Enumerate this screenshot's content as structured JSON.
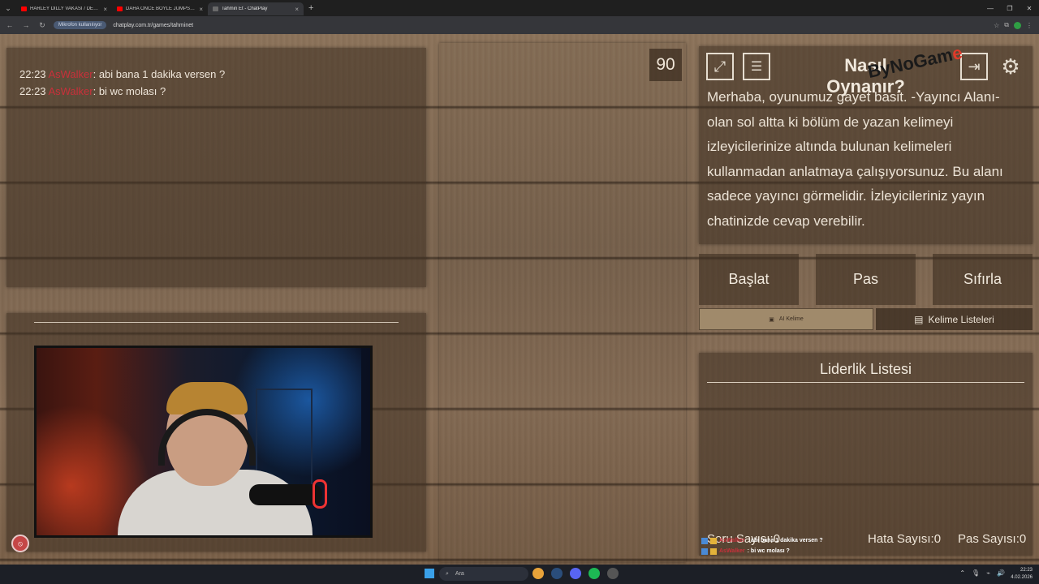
{
  "browser": {
    "tabs": [
      {
        "title": "HARLEY DILLY VAKASI / DEDEK",
        "favicon": "youtube-icon",
        "active": false
      },
      {
        "title": "DAHA ÖNCE BÖYLE JUMPSCAR",
        "favicon": "youtube-icon",
        "active": false
      },
      {
        "title": "Tahmin Et - ChatPlay",
        "favicon": "chatplay-icon",
        "active": true
      }
    ],
    "site_chip": "Mikrofon kullanılıyor",
    "url": "chatplay.com.tr/games/tahminet"
  },
  "chat": {
    "messages": [
      {
        "time": "22:23",
        "user": "AsWalker",
        "text": ": abi bana 1 dakika versen ?"
      },
      {
        "time": "22:23",
        "user": "AsWalker",
        "text": ": bi wc molası ?"
      }
    ]
  },
  "timer": "90",
  "help": {
    "title": "Nasıl Oynanır?",
    "text": "Merhaba, oyunumuz gayet basit. -Yayıncı Alanı- olan sol altta ki bölüm de yazan kelimeyi izleyicilerinize altında bulunan kelimeleri kullanmadan anlatmaya çalışıyorsunuz. Bu alanı sadece yayıncı görmelidir. İzleyicileriniz yayın chatinizde cevap verebilir."
  },
  "buttons": {
    "start": "Başlat",
    "pass": "Pas",
    "reset": "Sıfırla"
  },
  "word_tabs": {
    "ai": "AI Kelime",
    "lists": "Kelime Listeleri"
  },
  "leaderboard": {
    "title": "Liderlik Listesi"
  },
  "stats": {
    "questions": "Soru Sayısı:0",
    "errors": "Hata Sayısı:0",
    "passes": "Pas Sayısı:0"
  },
  "overlay_chat": [
    {
      "user": "AsWalker",
      "text": ": abi bana 1 dakika versen ?"
    },
    {
      "user": "AsWalker",
      "text": ": bi wc molası ?"
    }
  ],
  "watermark": {
    "main": "ByNoGam",
    "accent": "e"
  },
  "taskbar": {
    "search_placeholder": "Ara",
    "time": "22:23",
    "date": "4.02.2026"
  },
  "colors": {
    "username": "#c8303a",
    "wood": "#8c735a",
    "panel": "#3c2d20"
  }
}
